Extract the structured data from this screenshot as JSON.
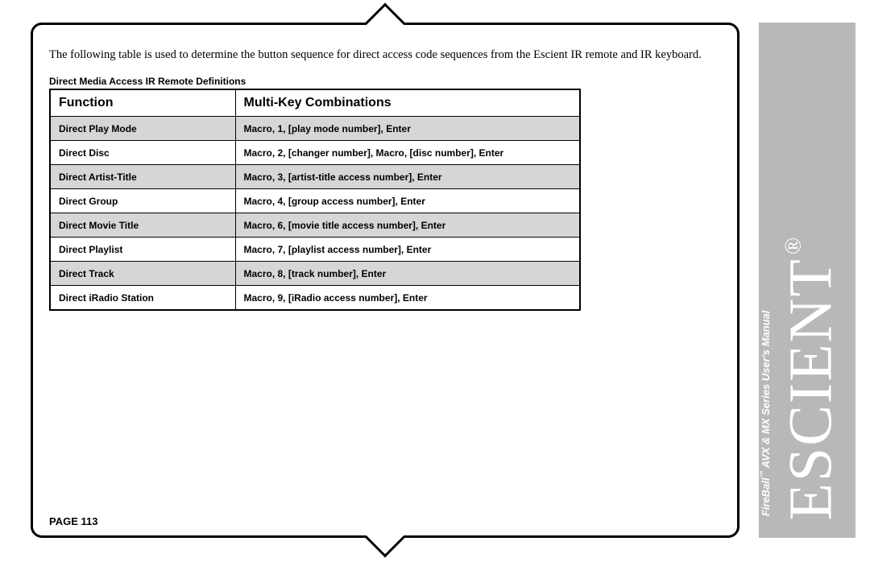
{
  "intro": "The following table is used to determine the button sequence for direct access code sequences from the Escient IR remote and IR keyboard.",
  "table_caption": "Direct Media Access IR Remote Definitions",
  "headers": {
    "function": "Function",
    "combo": "Multi-Key Combinations"
  },
  "rows": [
    {
      "function": "Direct Play Mode",
      "combo": "Macro, 1, [play mode number], Enter"
    },
    {
      "function": "Direct Disc",
      "combo": "Macro, 2, [changer number], Macro, [disc number], Enter"
    },
    {
      "function": "Direct Artist-Title",
      "combo": "Macro, 3, [artist-title access number], Enter"
    },
    {
      "function": "Direct Group",
      "combo": "Macro, 4, [group access number], Enter"
    },
    {
      "function": "Direct Movie Title",
      "combo": "Macro, 6, [movie title access number], Enter"
    },
    {
      "function": "Direct Playlist",
      "combo": "Macro, 7, [playlist access number], Enter"
    },
    {
      "function": "Direct Track",
      "combo": "Macro, 8, [track number], Enter"
    },
    {
      "function": "Direct iRadio Station",
      "combo": "Macro, 9, [iRadio access number], Enter"
    }
  ],
  "page_number": "PAGE 113",
  "brand": "ESCIENT",
  "registered": "®",
  "manual_line_prefix": "FireBall",
  "manual_line_tm": "™",
  "manual_line_suffix": " AVX & MX Series User's Manual"
}
